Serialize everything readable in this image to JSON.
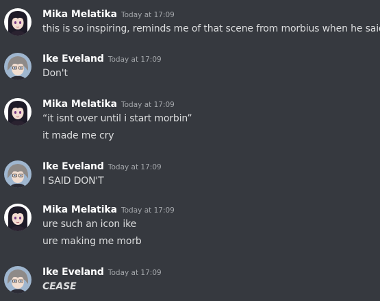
{
  "messages": [
    {
      "author": "Mika Melatika",
      "avatar_icon": "mika-avatar-icon",
      "timestamp": "Today at 17:09",
      "lines": [
        "this is so inspiring, reminds me of that scene from morbius when he said"
      ]
    },
    {
      "author": "Ike Eveland",
      "avatar_icon": "ike-avatar-icon",
      "timestamp": "Today at 17:09",
      "lines": [
        "Don't"
      ]
    },
    {
      "author": "Mika Melatika",
      "avatar_icon": "mika-avatar-icon",
      "timestamp": "Today at 17:09",
      "lines": [
        "“it isnt over until i start morbin”",
        "it made me cry"
      ]
    },
    {
      "author": "Ike Eveland",
      "avatar_icon": "ike-avatar-icon",
      "timestamp": "Today at 17:09",
      "lines": [
        "I SAID DON'T"
      ]
    },
    {
      "author": "Mika Melatika",
      "avatar_icon": "mika-avatar-icon",
      "timestamp": "Today at 17:09",
      "lines": [
        "ure such an icon ike",
        "ure making me morb"
      ]
    },
    {
      "author": "Ike Eveland",
      "avatar_icon": "ike-avatar-icon",
      "timestamp": "Today at 17:09",
      "lines": [
        "CEASE"
      ]
    }
  ],
  "colors": {
    "background": "#36393f",
    "username": "#ffffff",
    "timestamp": "#a3a6aa",
    "message_text": "#dcddde"
  }
}
